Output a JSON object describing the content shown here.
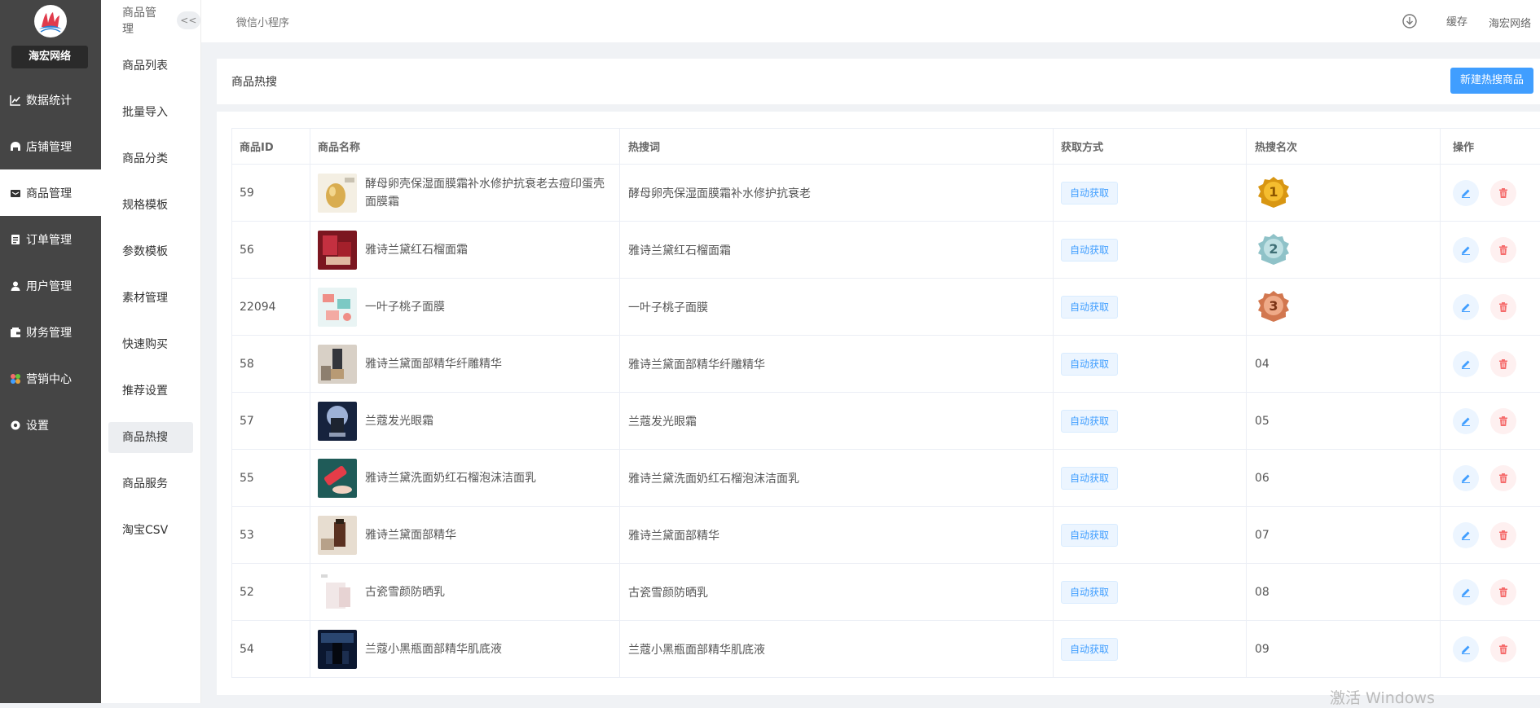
{
  "brand": {
    "name": "海宏网络"
  },
  "nav": [
    {
      "label": "数据统计",
      "icon": "chart-line-icon",
      "active": false
    },
    {
      "label": "店铺管理",
      "icon": "store-icon",
      "active": false
    },
    {
      "label": "商品管理",
      "icon": "goods-icon",
      "active": true
    },
    {
      "label": "订单管理",
      "icon": "order-icon",
      "active": false
    },
    {
      "label": "用户管理",
      "icon": "user-icon",
      "active": false
    },
    {
      "label": "财务管理",
      "icon": "wallet-icon",
      "active": false
    },
    {
      "label": "营销中心",
      "icon": "marketing-icon",
      "active": false
    },
    {
      "label": "设置",
      "icon": "gear-icon",
      "active": false
    }
  ],
  "subnav": {
    "title": "商品管理",
    "collapse_label": "<<",
    "items": [
      {
        "label": "商品列表",
        "active": false
      },
      {
        "label": "批量导入",
        "active": false
      },
      {
        "label": "商品分类",
        "active": false
      },
      {
        "label": "规格模板",
        "active": false
      },
      {
        "label": "参数模板",
        "active": false
      },
      {
        "label": "素材管理",
        "active": false
      },
      {
        "label": "快速购买",
        "active": false
      },
      {
        "label": "推荐设置",
        "active": false
      },
      {
        "label": "商品热搜",
        "active": true
      },
      {
        "label": "商品服务",
        "active": false
      },
      {
        "label": "淘宝CSV",
        "active": false
      }
    ]
  },
  "header": {
    "mini_program": "微信小程序",
    "cache_label": "缓存",
    "user_label": "海宏网络"
  },
  "page": {
    "title": "商品热搜",
    "add_button": "新建热搜商品"
  },
  "table": {
    "columns": [
      "商品ID",
      "商品名称",
      "热搜词",
      "获取方式",
      "热搜名次",
      "操作"
    ],
    "rows": [
      {
        "id": "59",
        "name": "酵母卵壳保湿面膜霜补水修护抗衰老去痘印蛋壳面膜霜",
        "keyword": "酵母卵壳保湿面膜霜补水修护抗衰老",
        "source": "自动获取",
        "rank": "1",
        "medal": "gold",
        "thumb": "egg"
      },
      {
        "id": "56",
        "name": "雅诗兰黛红石榴面霜",
        "keyword": "雅诗兰黛红石榴面霜",
        "source": "自动获取",
        "rank": "2",
        "medal": "silver",
        "thumb": "red"
      },
      {
        "id": "22094",
        "name": "一叶子桃子面膜",
        "keyword": "一叶子桃子面膜",
        "source": "自动获取",
        "rank": "3",
        "medal": "bronze",
        "thumb": "peach"
      },
      {
        "id": "58",
        "name": "雅诗兰黛面部精华纤雕精华",
        "keyword": "雅诗兰黛面部精华纤雕精华",
        "source": "自动获取",
        "rank": "04",
        "medal": "",
        "thumb": "serum"
      },
      {
        "id": "57",
        "name": "兰蔻发光眼霜",
        "keyword": "兰蔻发光眼霜",
        "source": "自动获取",
        "rank": "05",
        "medal": "",
        "thumb": "eye"
      },
      {
        "id": "55",
        "name": "雅诗兰黛洗面奶红石榴泡沫洁面乳",
        "keyword": "雅诗兰黛洗面奶红石榴泡沫洁面乳",
        "source": "自动获取",
        "rank": "06",
        "medal": "",
        "thumb": "cleanser"
      },
      {
        "id": "53",
        "name": "雅诗兰黛面部精华",
        "keyword": "雅诗兰黛面部精华",
        "source": "自动获取",
        "rank": "07",
        "medal": "",
        "thumb": "brown"
      },
      {
        "id": "52",
        "name": "古瓷雪颜防晒乳",
        "keyword": "古瓷雪颜防晒乳",
        "source": "自动获取",
        "rank": "08",
        "medal": "",
        "thumb": "white"
      },
      {
        "id": "54",
        "name": "兰蔻小黑瓶面部精华肌底液",
        "keyword": "兰蔻小黑瓶面部精华肌底液",
        "source": "自动获取",
        "rank": "09",
        "medal": "",
        "thumb": "darkblue"
      }
    ]
  },
  "watermark": "激活 Windows",
  "colors": {
    "sidebar_bg": "#454545",
    "primary": "#409eff",
    "danger": "#f56c6c"
  }
}
